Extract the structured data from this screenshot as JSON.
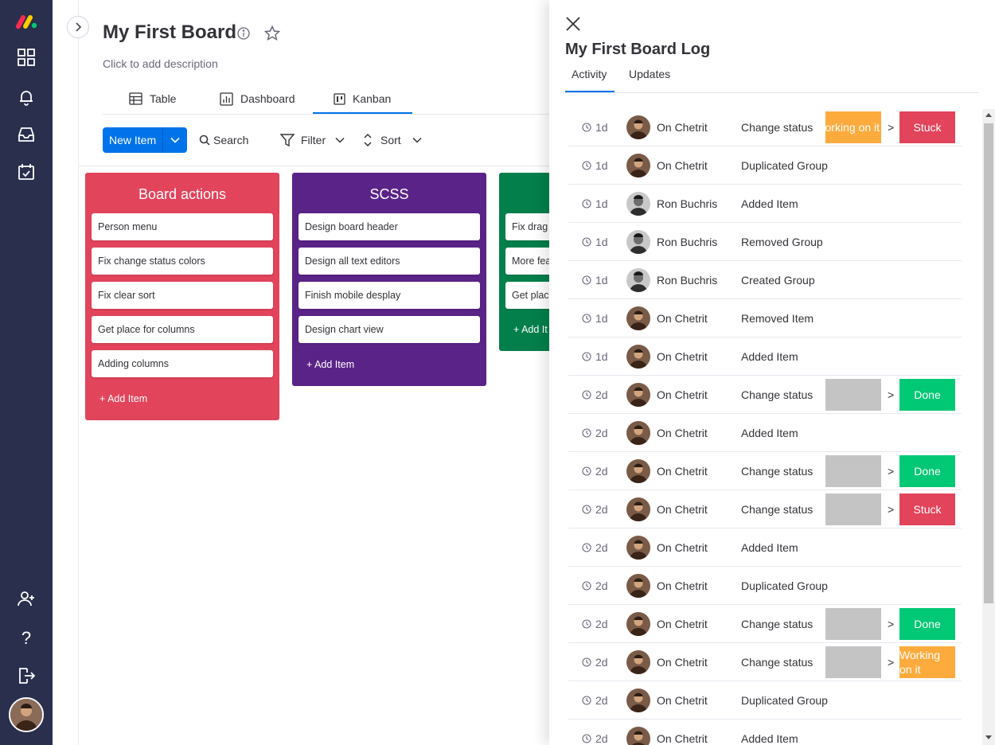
{
  "board": {
    "title": "My First Board",
    "description": "Click to add description",
    "views": [
      {
        "label": "Table",
        "icon": "table-icon"
      },
      {
        "label": "Dashboard",
        "icon": "dashboard-icon"
      },
      {
        "label": "Kanban",
        "icon": "kanban-icon",
        "active": true
      }
    ],
    "toolbar": {
      "new_item": "New Item",
      "search": "Search",
      "filter": "Filter",
      "sort": "Sort"
    },
    "groups": [
      {
        "title": "Board actions",
        "color": "#e2445c",
        "items": [
          "Person menu",
          "Fix change status colors",
          "Fix clear sort",
          "Get place for columns",
          "Adding columns"
        ],
        "add_label": "+ Add Item"
      },
      {
        "title": "SCSS",
        "color": "#5a2387",
        "items": [
          "Design board header",
          "Design all text editors",
          "Finish mobile desplay",
          "Design chart view"
        ],
        "add_label": "+ Add Item"
      },
      {
        "title": "",
        "color": "#037f4c",
        "items": [
          "Fix drag",
          "More fea",
          "Get plac"
        ],
        "add_label": "+ Add It"
      }
    ]
  },
  "panel": {
    "title": "My First Board Log",
    "tabs": [
      "Activity",
      "Updates"
    ],
    "status_colors": {
      "Working on it": "#fdab3d",
      "Stuck": "#e2445c",
      "Done": "#00c875",
      "empty": "#c4c4c4"
    },
    "log": [
      {
        "time": "1d",
        "user": "On Chetrit",
        "action": "Change status",
        "from": "Working on it",
        "to": "Stuck"
      },
      {
        "time": "1d",
        "user": "On Chetrit",
        "action": "Duplicated Group"
      },
      {
        "time": "1d",
        "user": "Ron Buchris",
        "action": "Added Item"
      },
      {
        "time": "1d",
        "user": "Ron Buchris",
        "action": "Removed Group"
      },
      {
        "time": "1d",
        "user": "Ron Buchris",
        "action": "Created Group"
      },
      {
        "time": "1d",
        "user": "On Chetrit",
        "action": "Removed Item"
      },
      {
        "time": "1d",
        "user": "On Chetrit",
        "action": "Added Item"
      },
      {
        "time": "2d",
        "user": "On Chetrit",
        "action": "Change status",
        "from": "",
        "to": "Done"
      },
      {
        "time": "2d",
        "user": "On Chetrit",
        "action": "Added Item"
      },
      {
        "time": "2d",
        "user": "On Chetrit",
        "action": "Change status",
        "from": "",
        "to": "Done"
      },
      {
        "time": "2d",
        "user": "On Chetrit",
        "action": "Change status",
        "from": "",
        "to": "Stuck"
      },
      {
        "time": "2d",
        "user": "On Chetrit",
        "action": "Added Item"
      },
      {
        "time": "2d",
        "user": "On Chetrit",
        "action": "Duplicated Group"
      },
      {
        "time": "2d",
        "user": "On Chetrit",
        "action": "Change status",
        "from": "",
        "to": "Done"
      },
      {
        "time": "2d",
        "user": "On Chetrit",
        "action": "Change status",
        "from": "",
        "to": "Working on it"
      },
      {
        "time": "2d",
        "user": "On Chetrit",
        "action": "Duplicated Group"
      },
      {
        "time": "2d",
        "user": "On Chetrit",
        "action": "Added Item"
      }
    ],
    "arrow": ">"
  }
}
